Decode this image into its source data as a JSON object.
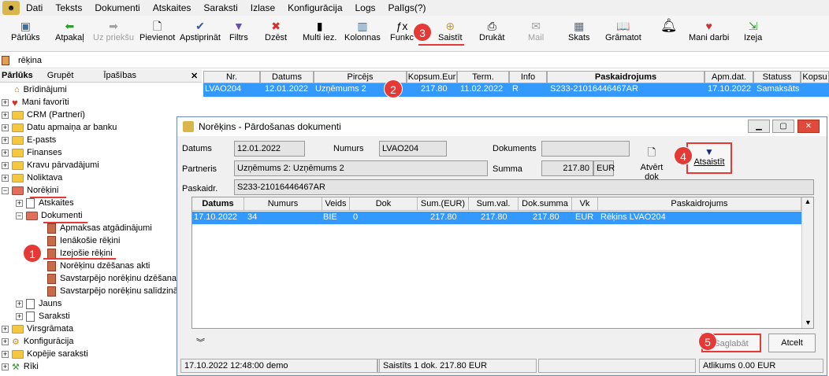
{
  "menu": [
    "Dati",
    "Teksts",
    "Dokumenti",
    "Atskaites",
    "Saraksti",
    "Izlase",
    "Konfigurācija",
    "Logs",
    "Palīgs(?)"
  ],
  "toolbar": {
    "parluks": "Pārlūks",
    "atpakal": "Atpakaļ",
    "uz_prieksu": "Uz priekšu",
    "pievienot": "Pievienot",
    "apstiprinat": "Apstiprināt",
    "filtrs": "Filtrs",
    "dzest": "Dzēst",
    "multi": "Multi iez.",
    "kolonnas": "Kolonnas",
    "funkcijas": "Funkc",
    "saistit": "Saistīt",
    "drukat": "Drukāt",
    "mail": "Mail",
    "skats": "Skats",
    "gramatot": "Grāmatot",
    "mani_darbi": "Mani darbi",
    "izeja": "Izeja"
  },
  "tab": {
    "label": "rēķina"
  },
  "left_panel": {
    "tabs": [
      "Pārlūks",
      "Grupēt",
      "Īpašības"
    ],
    "close": "✕"
  },
  "tree": {
    "items": [
      "Brīdinājumi",
      "Mani favorīti",
      "CRM (Partneri)",
      "Datu apmaiņa ar banku",
      "E-pasts",
      "Finanses",
      "Kravu pārvadājumi",
      "Noliktava",
      "Norēķini",
      "Atskaites",
      "Dokumenti",
      "Apmaksas atgādinājumi",
      "Ienākošie rēķini",
      "Izejošie rēķini",
      "Norēķinu dzēšanas akti",
      "Savstarpējo norēķinu dzēšana",
      "Savstarpējo norēķinu salīdzinā",
      "Jauns",
      "Saraksti",
      "Virsgrāmata",
      "Konfigurācija",
      "Kopējie saraksti",
      "Rīki"
    ]
  },
  "top_grid": {
    "headers": [
      "Nr.",
      "Datums",
      "Pircējs",
      "Kopsum.Eur",
      "Term.",
      "Info",
      "Paskaidrojums",
      "Apm.dat.",
      "Statuss",
      "Kopsu"
    ],
    "row": [
      "LVAO204",
      "12.01.2022",
      "Uzņēmums 2",
      "217.80",
      "11.02.2022",
      "R",
      "S233-21016446467AR",
      "17.10.2022",
      "Samaksāts",
      ""
    ]
  },
  "dialog": {
    "title": "Norēķins - Pārdošanas dokumenti",
    "labels": {
      "datums": "Datums",
      "numurs": "Numurs",
      "dokuments": "Dokuments",
      "partneris": "Partneris",
      "summa": "Summa",
      "paskaidr": "Paskaidr."
    },
    "values": {
      "datums": "12.01.2022",
      "numurs": "LVAO204",
      "dokuments": "",
      "partneris": "Uzņēmums 2: Uzņēmums 2",
      "summa": "217.80",
      "currency": "EUR",
      "paskaidr": "S233-21016446467AR"
    },
    "atvert_dok": "Atvērt dok",
    "atsaistit": "Atsaistīt",
    "grid_headers": [
      "Datums",
      "Numurs",
      "Veids",
      "Dok",
      "Sum.(EUR)",
      "Sum.val.",
      "Dok.summa",
      "Vk",
      "Paskaidrojums"
    ],
    "grid_row": [
      "17.10.2022",
      "34",
      "BIE",
      "0",
      "217.80",
      "217.80",
      "217.80",
      "EUR",
      "Rēķins LVAO204"
    ],
    "saglabat": "Saglabāt",
    "atcelt": "Atcelt",
    "status": [
      "17.10.2022 12:48:00 demo",
      "",
      "Saistīts 1 dok. 217.80 EUR",
      "",
      "Atlikums 0.00 EUR"
    ]
  },
  "badges": [
    "1",
    "2",
    "3",
    "4",
    "5"
  ],
  "colors": {
    "selection": "#3399ff",
    "annotation": "#e53935"
  }
}
